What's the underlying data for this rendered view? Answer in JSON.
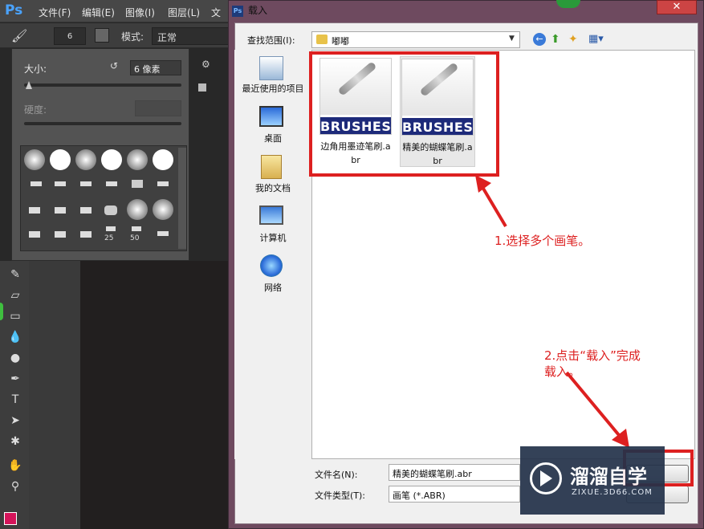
{
  "ps": {
    "logo": "Ps",
    "menu": [
      "文件(F)",
      "编辑(E)",
      "图像(I)",
      "图层(L)",
      "文"
    ]
  },
  "options": {
    "brush_size": "6",
    "mode_label": "模式:",
    "mode_value": "正常"
  },
  "brush_panel": {
    "size_label": "大小:",
    "size_value": "6 像素",
    "hardness_label": "硬度:",
    "presets": [
      "",
      "",
      "",
      "",
      "",
      "",
      "",
      "",
      "",
      "",
      "",
      "",
      "",
      "",
      "",
      "",
      "",
      "",
      "25",
      "50",
      "",
      ""
    ]
  },
  "dialog": {
    "title": "载入",
    "lookin_label": "查找范围(I):",
    "lookin_value": "嘟嘟",
    "places": [
      {
        "label": "最近使用的项目",
        "icon": "recent-icon"
      },
      {
        "label": "桌面",
        "icon": "desktop-icon"
      },
      {
        "label": "我的文档",
        "icon": "documents-icon"
      },
      {
        "label": "计算机",
        "icon": "computer-icon"
      },
      {
        "label": "网络",
        "icon": "network-icon"
      }
    ],
    "files": [
      {
        "name": "边角用墨迹笔刷.abr",
        "badge": "BRUSHES"
      },
      {
        "name": "精美的蝴蝶笔刷.abr",
        "badge": "BRUSHES"
      }
    ],
    "filename_label": "文件名(N):",
    "filename_value": "精美的蝴蝶笔刷.abr",
    "filetype_label": "文件类型(T):",
    "filetype_value": "画笔 (*.ABR)"
  },
  "annotations": {
    "step1": "1.选择多个画笔。",
    "step2_line1": "2.点击“载入”完成",
    "step2_line2": "载入。"
  },
  "watermark": {
    "brand": "溜溜自学",
    "url": "ZIXUE.3D66.COM"
  },
  "colors": {
    "annotation": "#dd2020",
    "dialog_frame": "#6e4a5f"
  }
}
